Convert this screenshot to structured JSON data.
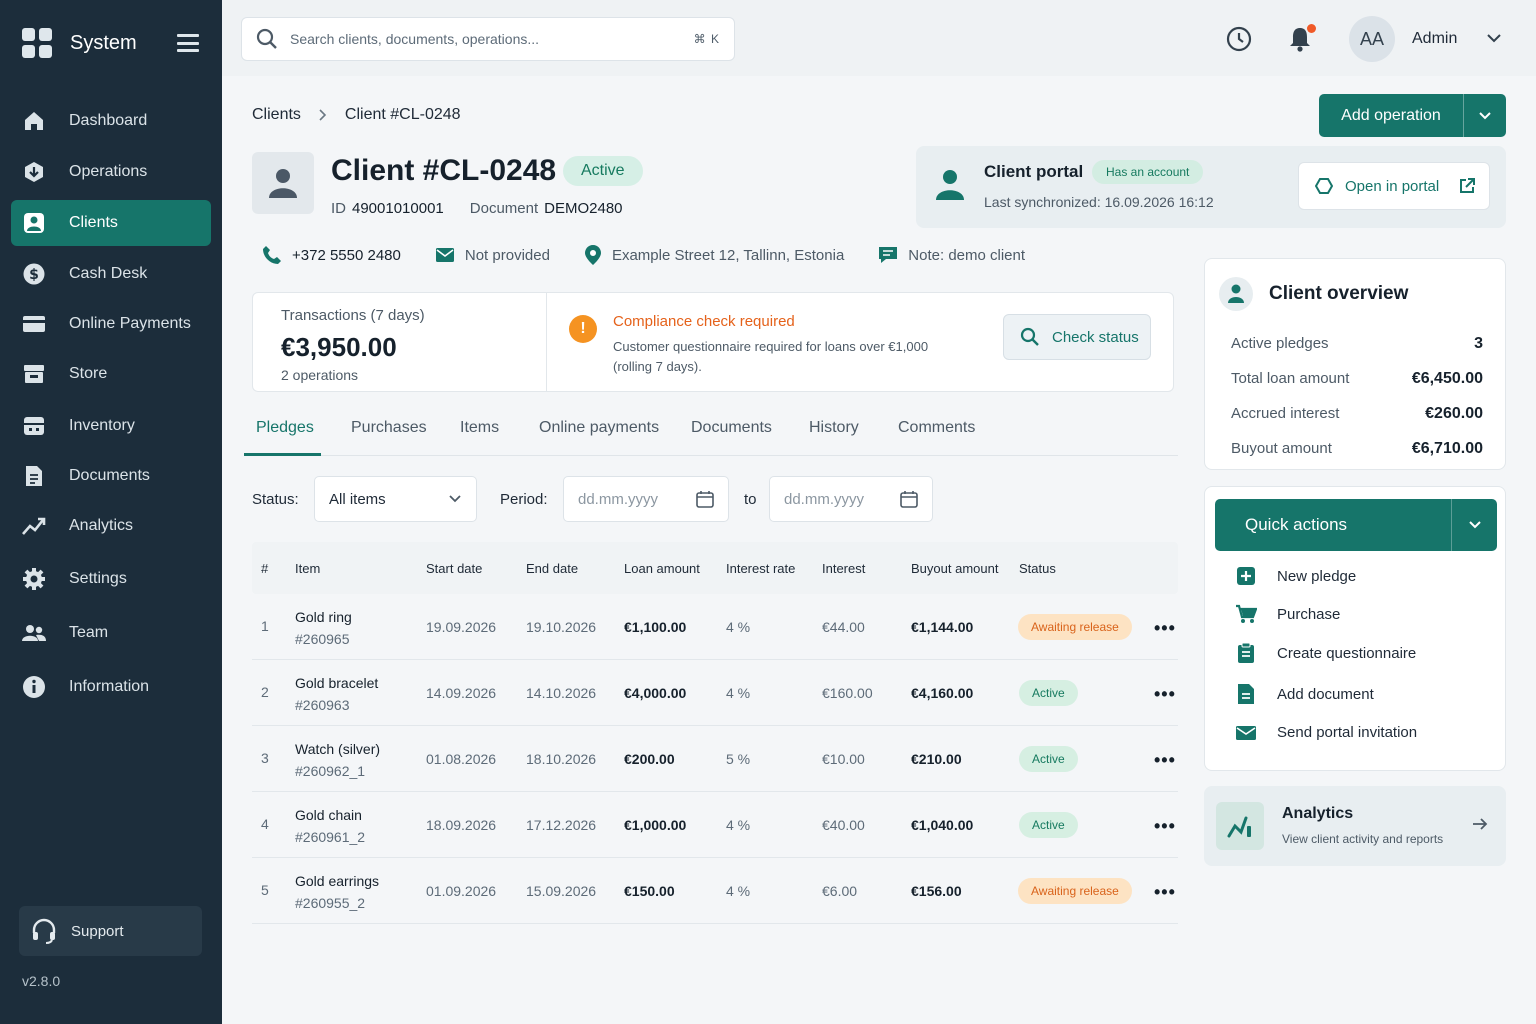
{
  "sidebar": {
    "brand": "System",
    "items": [
      {
        "label": "Dashboard",
        "icon": "home-icon"
      },
      {
        "label": "Operations",
        "icon": "operations-icon"
      },
      {
        "label": "Clients",
        "icon": "user-icon",
        "active": true
      },
      {
        "label": "Cash Desk",
        "icon": "dollar-icon"
      },
      {
        "label": "Online Payments",
        "icon": "card-icon"
      },
      {
        "label": "Store",
        "icon": "store-icon"
      },
      {
        "label": "Inventory",
        "icon": "inventory-icon"
      },
      {
        "label": "Documents",
        "icon": "document-icon"
      },
      {
        "label": "Analytics",
        "icon": "chart-icon"
      },
      {
        "label": "Settings",
        "icon": "gear-icon"
      },
      {
        "label": "Team",
        "icon": "team-icon"
      },
      {
        "label": "Information",
        "icon": "info-icon"
      }
    ],
    "support": "Support",
    "version": "v2.8.0"
  },
  "topbar": {
    "search_placeholder": "Search clients, documents, operations...",
    "shortcut": "⌘ K",
    "avatar_initials": "AA",
    "user": "Admin"
  },
  "breadcrumb": {
    "root": "Clients",
    "current": "Client #CL-0248"
  },
  "actions": {
    "add_operation": "Add operation"
  },
  "client": {
    "title": "Client #CL-0248",
    "status": "Active",
    "id_label": "ID",
    "id_value": "49001010001",
    "doc_label": "Document",
    "doc_value": "DEMO2480",
    "phone": "+372 5550 2480",
    "email": "Not provided",
    "address": "Example Street 12, Tallinn, Estonia",
    "note": "Note: demo client"
  },
  "portal": {
    "title": "Client portal",
    "badge": "Has an account",
    "sync": "Last synchronized: 16.09.2026 16:12",
    "open": "Open in portal"
  },
  "stats": {
    "label": "Transactions (7 days)",
    "value": "€3,950.00",
    "sub": "2 operations",
    "warning_title": "Compliance check required",
    "warning_desc": "Customer questionnaire required for loans over €1,000 (rolling 7 days).",
    "check_button": "Check status"
  },
  "tabs": [
    "Pledges",
    "Purchases",
    "Items",
    "Online payments",
    "Documents",
    "History",
    "Comments"
  ],
  "filters": {
    "status_label": "Status:",
    "status_value": "All items",
    "period_label": "Period:",
    "from_placeholder": "dd.mm.yyyy",
    "to_label": "to",
    "to_placeholder": "dd.mm.yyyy"
  },
  "table": {
    "headers": [
      "#",
      "Item",
      "Start date",
      "End date",
      "Loan amount",
      "Interest rate",
      "Interest",
      "Buyout amount",
      "Status"
    ],
    "rows": [
      {
        "n": "1",
        "item": "Gold ring",
        "sku": "#260965",
        "start": "19.09.2026",
        "end": "19.10.2026",
        "loan": "€1,100.00",
        "rate": "4 %",
        "interest": "€44.00",
        "buyout": "€1,144.00",
        "status": "Awaiting release",
        "kind": "wait"
      },
      {
        "n": "2",
        "item": "Gold bracelet",
        "sku": "#260963",
        "start": "14.09.2026",
        "end": "14.10.2026",
        "loan": "€4,000.00",
        "rate": "4 %",
        "interest": "€160.00",
        "buyout": "€4,160.00",
        "status": "Active",
        "kind": "act"
      },
      {
        "n": "3",
        "item": "Watch (silver)",
        "sku": "#260962_1",
        "start": "01.08.2026",
        "end": "18.10.2026",
        "loan": "€200.00",
        "rate": "5 %",
        "interest": "€10.00",
        "buyout": "€210.00",
        "status": "Active",
        "kind": "act"
      },
      {
        "n": "4",
        "item": "Gold chain",
        "sku": "#260961_2",
        "start": "18.09.2026",
        "end": "17.12.2026",
        "loan": "€1,000.00",
        "rate": "4 %",
        "interest": "€40.00",
        "buyout": "€1,040.00",
        "status": "Active",
        "kind": "act"
      },
      {
        "n": "5",
        "item": "Gold earrings",
        "sku": "#260955_2",
        "start": "01.09.2026",
        "end": "15.09.2026",
        "loan": "€150.00",
        "rate": "4 %",
        "interest": "€6.00",
        "buyout": "€156.00",
        "status": "Awaiting release",
        "kind": "wait"
      }
    ]
  },
  "overview": {
    "title": "Client overview",
    "rows": [
      {
        "label": "Active pledges",
        "value": "3"
      },
      {
        "label": "Total loan amount",
        "value": "€6,450.00"
      },
      {
        "label": "Accrued interest",
        "value": "€260.00"
      },
      {
        "label": "Buyout amount",
        "value": "€6,710.00"
      }
    ]
  },
  "quick_actions": {
    "title": "Quick actions",
    "items": [
      {
        "label": "New pledge",
        "icon": "plus-square-icon"
      },
      {
        "label": "Purchase",
        "icon": "cart-icon"
      },
      {
        "label": "Create questionnaire",
        "icon": "clipboard-icon"
      },
      {
        "label": "Add document",
        "icon": "document-icon"
      },
      {
        "label": "Send portal invitation",
        "icon": "mail-icon"
      }
    ]
  },
  "analytics_card": {
    "title": "Analytics",
    "sub": "View client activity and reports"
  },
  "colors": {
    "accent": "#16756a",
    "sidebar": "#1c2d3b",
    "warning": "#e5621b"
  }
}
